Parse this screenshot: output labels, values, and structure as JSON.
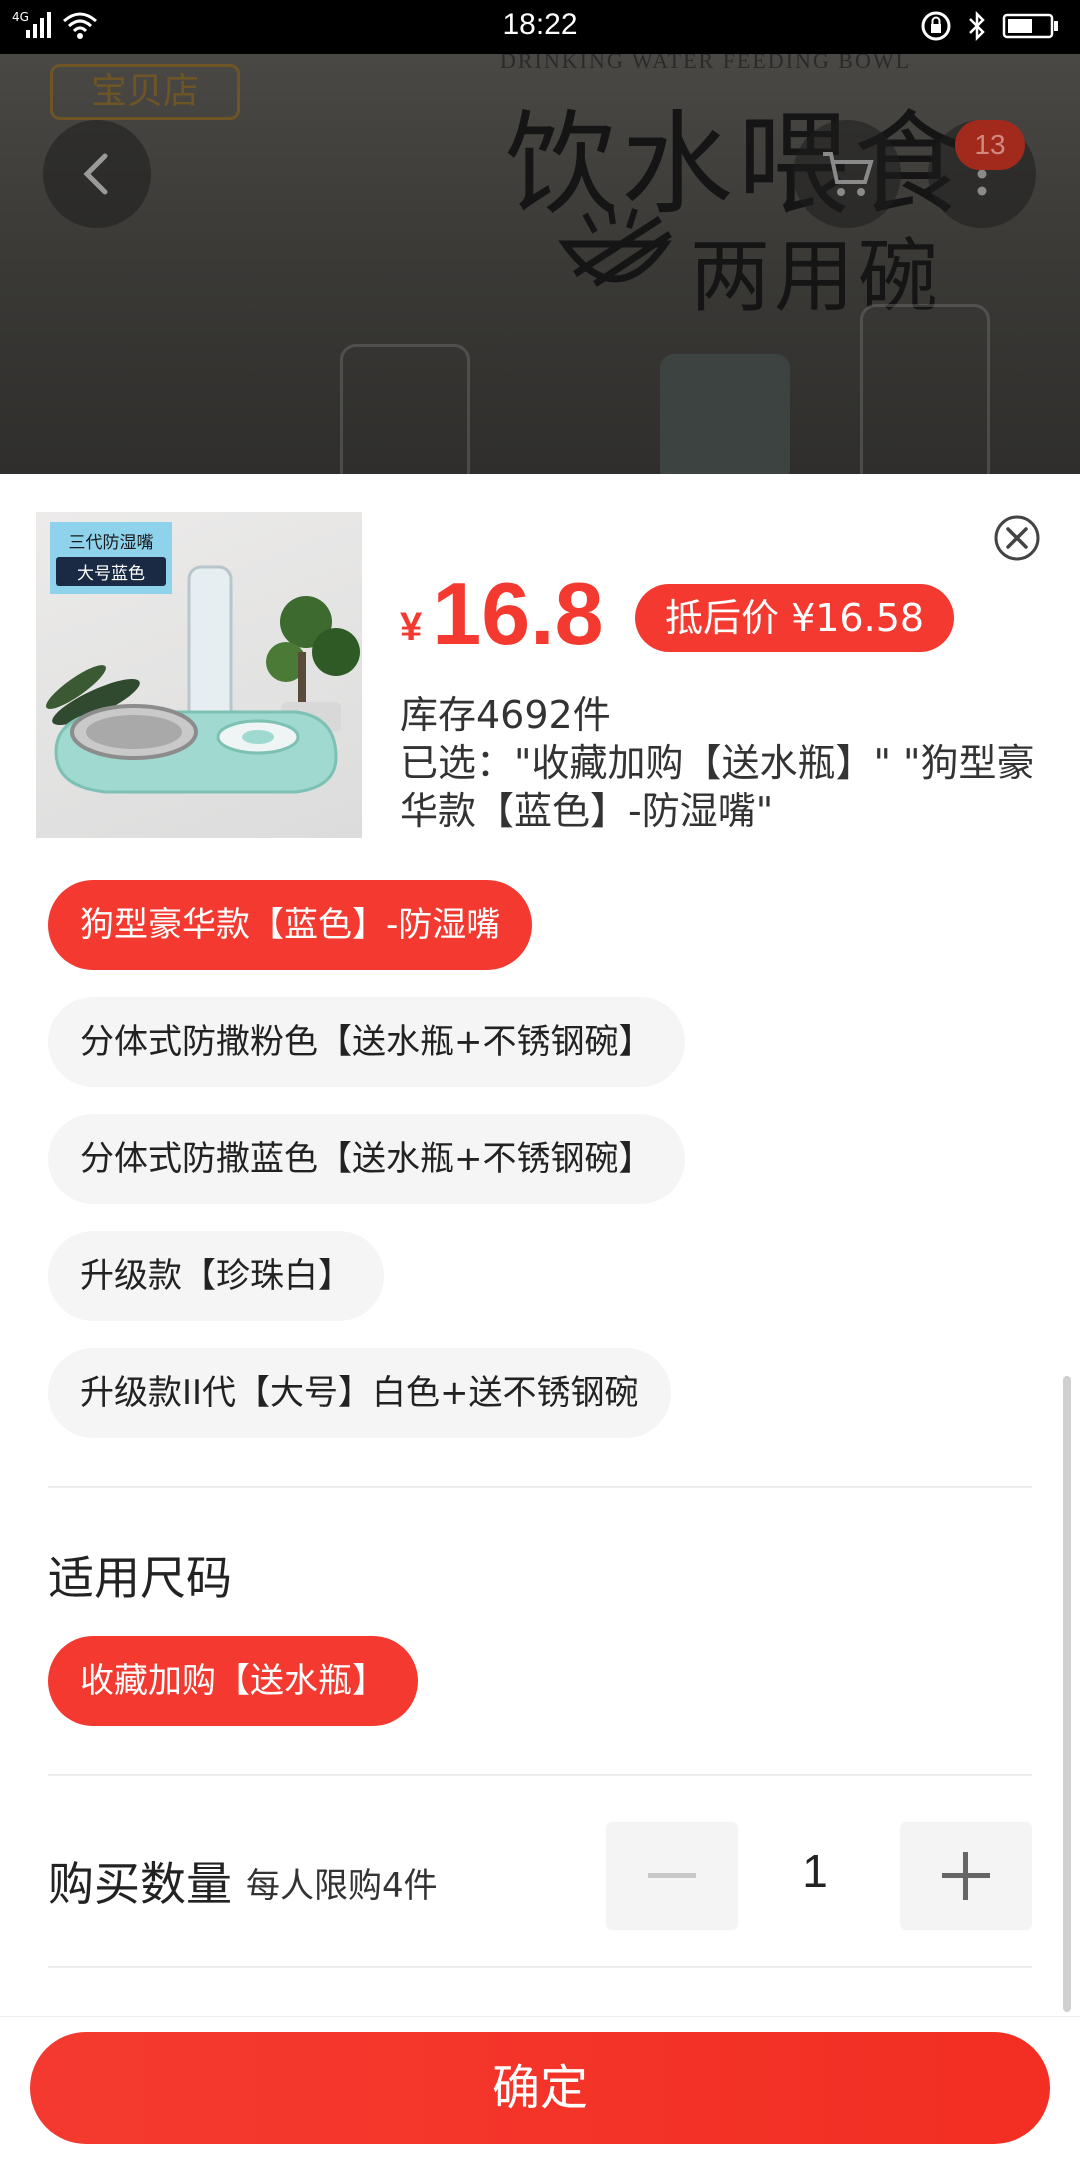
{
  "status_bar": {
    "network_type": "4G",
    "time": "18:22"
  },
  "hero": {
    "store_badge": "宝贝店",
    "english_line": "DRINKING WATER FEEDING BOWL",
    "title": "饮水喂食",
    "subtitle": "两用碗",
    "cart_count": "13"
  },
  "product": {
    "thumbnail_tag_line1": "三代防湿嘴",
    "thumbnail_tag_line2": "大号蓝色",
    "currency_symbol": "¥",
    "price": "16.8",
    "after_discount_label": "抵后价 ¥16.58",
    "stock": "库存4692件",
    "selected": "已选：\"收藏加购【送水瓶】\" \"狗型豪华款【蓝色】-防湿嘴\""
  },
  "options": [
    {
      "label": "狗型豪华款【蓝色】-防湿嘴",
      "selected": true
    },
    {
      "label": "分体式防撒粉色【送水瓶+不锈钢碗】",
      "selected": false
    },
    {
      "label": "分体式防撒蓝色【送水瓶+不锈钢碗】",
      "selected": false
    },
    {
      "label": "升级款【珍珠白】",
      "selected": false
    },
    {
      "label": "升级款II代【大号】白色+送不锈钢碗",
      "selected": false
    }
  ],
  "size_section": {
    "title": "适用尺码",
    "option": "收藏加购【送水瓶】"
  },
  "quantity": {
    "label": "购买数量",
    "note": "每人限购4件",
    "value": "1"
  },
  "confirm_label": "确定",
  "colors": {
    "accent": "#f43a30",
    "chip_bg": "#f5f5f5",
    "text": "#222222"
  }
}
